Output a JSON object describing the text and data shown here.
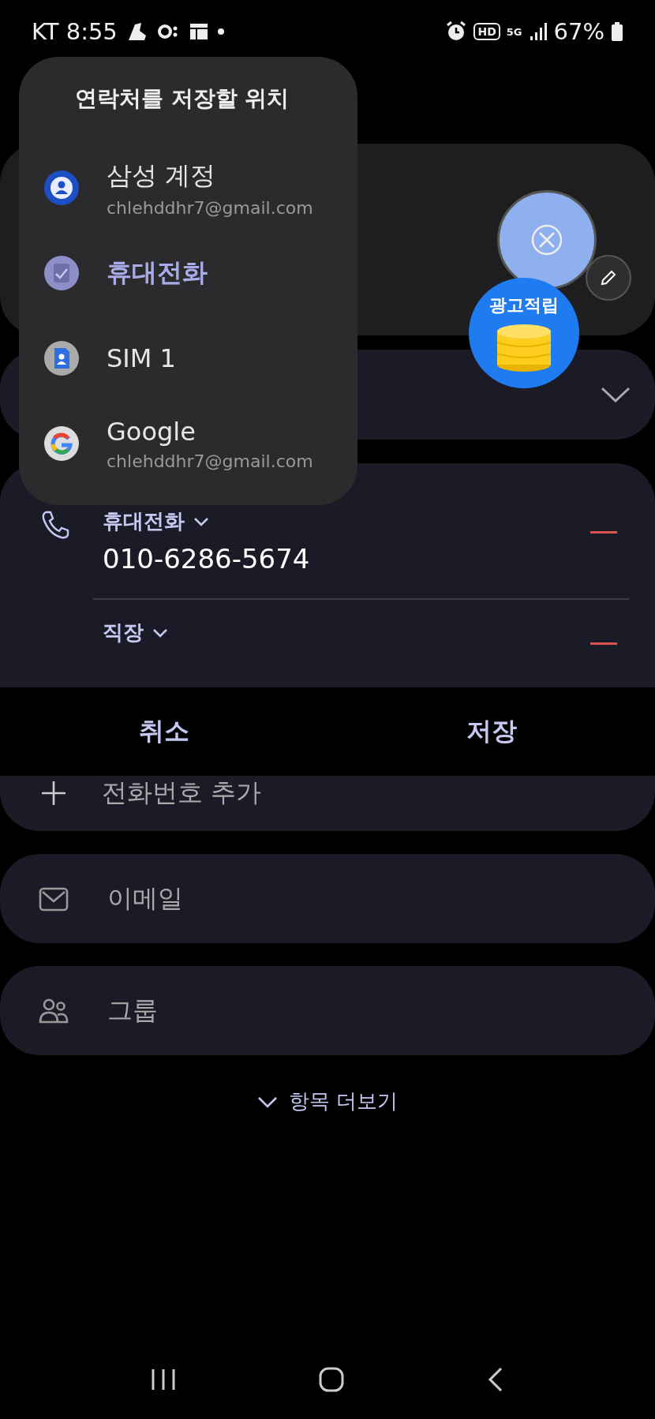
{
  "status_bar": {
    "carrier_time": "KT 8:55",
    "hd": "HD",
    "network": "5G",
    "battery": "67%"
  },
  "popup": {
    "title": "연락처를 저장할 위치",
    "options": [
      {
        "kind": "samsung",
        "label": "삼성 계정",
        "account": "chlehddhr7@gmail.com",
        "selected": false
      },
      {
        "kind": "phone",
        "label": "휴대전화",
        "selected": true
      },
      {
        "kind": "sim",
        "label": "SIM 1",
        "selected": false
      },
      {
        "kind": "google",
        "label": "Google",
        "account": "chlehddhr7@gmail.com",
        "selected": false
      }
    ]
  },
  "ad_badge": {
    "label": "광고적립"
  },
  "phone_section": {
    "entries": [
      {
        "label": "휴대전화",
        "value": "010-6286-5674"
      },
      {
        "label": "직장"
      }
    ],
    "add_label": "전화번호 추가"
  },
  "action_bar": {
    "cancel": "취소",
    "save": "저장"
  },
  "fields": [
    {
      "kind": "email",
      "placeholder": "이메일"
    },
    {
      "kind": "group",
      "placeholder": "그룹"
    }
  ],
  "more_label": "항목 더보기"
}
